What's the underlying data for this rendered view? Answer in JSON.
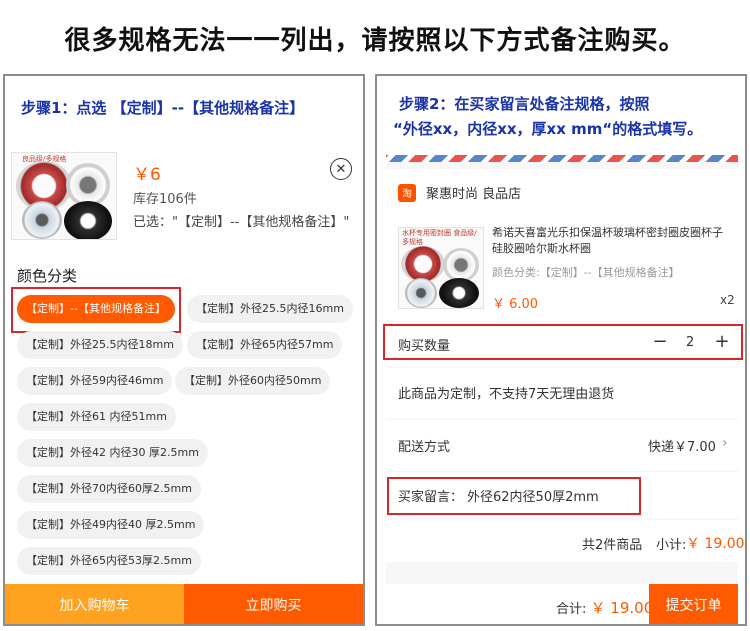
{
  "headline": "很多规格无法一一列出，请按照以下方式备注购买。",
  "left": {
    "step": "步骤1：点选 【定制】--【其他规格备注】",
    "thumb_tag": "良品级/多规格",
    "price": "￥6",
    "stock": "库存106件",
    "selected": "已选：\"【定制】--【其他规格备注】\"",
    "close_icon": "close-circle-icon",
    "section_title": "颜色分类",
    "chips": [
      "【定制】--【其他规格备注】",
      "【定制】外径25.5内径16mm",
      "【定制】外径25.5内径18mm",
      "【定制】外径65内径57mm",
      "【定制】外径59内径46mm",
      "【定制】外径60内径50mm",
      "【定制】外径61 内径51mm",
      "【定制】外径42 内径30 厚2.5mm",
      "【定制】外径70内径60厚2.5mm",
      "【定制】外径49内径40 厚2.5mm",
      "【定制】外径65内径53厚2.5mm"
    ],
    "add_to_cart": "加入购物车",
    "buy_now": "立即购买"
  },
  "right": {
    "step_line1": "步骤2：在买家留言处备注规格，按照",
    "step_line2": "“外径xx，内径xx，厚xx mm“的格式填写。",
    "shop_logo": "淘",
    "shop_name": "聚惠时尚 良品店",
    "thumb_tag": "水杯专用密封圈 食品级/多规格",
    "product_title": "希诺天喜富光乐扣保温杯玻璃杯密封圈皮圈杯子硅胶圈哈尔斯水杯圈",
    "product_variant": "颜色分类:【定制】--【其他规格备注】",
    "product_price": "￥ 6.00",
    "product_qty": "x2",
    "qty_label": "购买数量",
    "qty_minus": "−",
    "qty_value": "2",
    "qty_plus": "+",
    "notice": "此商品为定制，不支持7天无理由退货",
    "shipping_label": "配送方式",
    "shipping_value": "快递￥7.00",
    "message_label": "买家留言：",
    "message_value": "外径62内径50厚2mm",
    "summary_count": "共2件商品",
    "summary_subtotal_label": "小计:",
    "summary_subtotal": "￥ 19.00",
    "total_label": "合计:",
    "total_amount": "￥ 19.00",
    "submit": "提交订单"
  },
  "colors": {
    "accent": "#ff5a00",
    "cart": "#ffa21f",
    "step_text": "#1a33a8",
    "highlight_box": "#d8262c"
  }
}
